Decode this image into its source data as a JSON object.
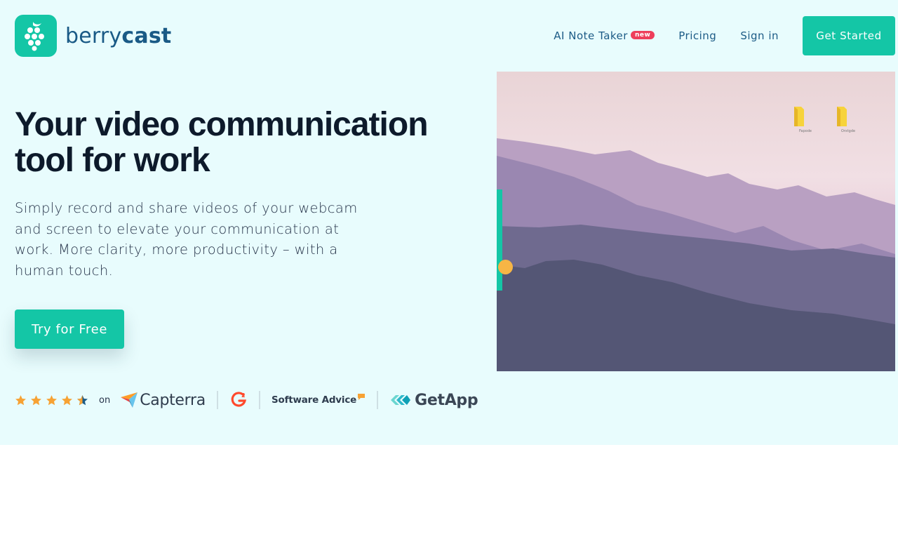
{
  "brand": {
    "name_part1": "berry",
    "name_part2": "cast",
    "color": "#14c6a6"
  },
  "nav": {
    "items": [
      {
        "label": "AI Note Taker",
        "badge": "new"
      },
      {
        "label": "Pricing"
      },
      {
        "label": "Sign in"
      }
    ],
    "cta_label": "Get Started"
  },
  "hero": {
    "headline": "Your video communication tool for work",
    "subtext": "Simply record and share videos of your webcam and screen to elevate your communication at work. More clarity, more productivity – with a human touch.",
    "cta_label": "Try for Free"
  },
  "reviews": {
    "rating": 4.5,
    "rating_max": 5,
    "on_label": "on",
    "sites": [
      "Capterra",
      "G2",
      "Software Advice",
      "GetApp"
    ]
  },
  "media": {
    "folders": [
      {
        "label": "Fapode"
      },
      {
        "label": "Orxtgde"
      }
    ],
    "scrub_position": 0.75
  },
  "colors": {
    "accent": "#14c6a6",
    "hero_bg": "#e8fcfd",
    "heading": "#0d1a2b",
    "nav_link": "#1c5b86",
    "badge": "#ee3e5b",
    "star": "#f7a234"
  }
}
